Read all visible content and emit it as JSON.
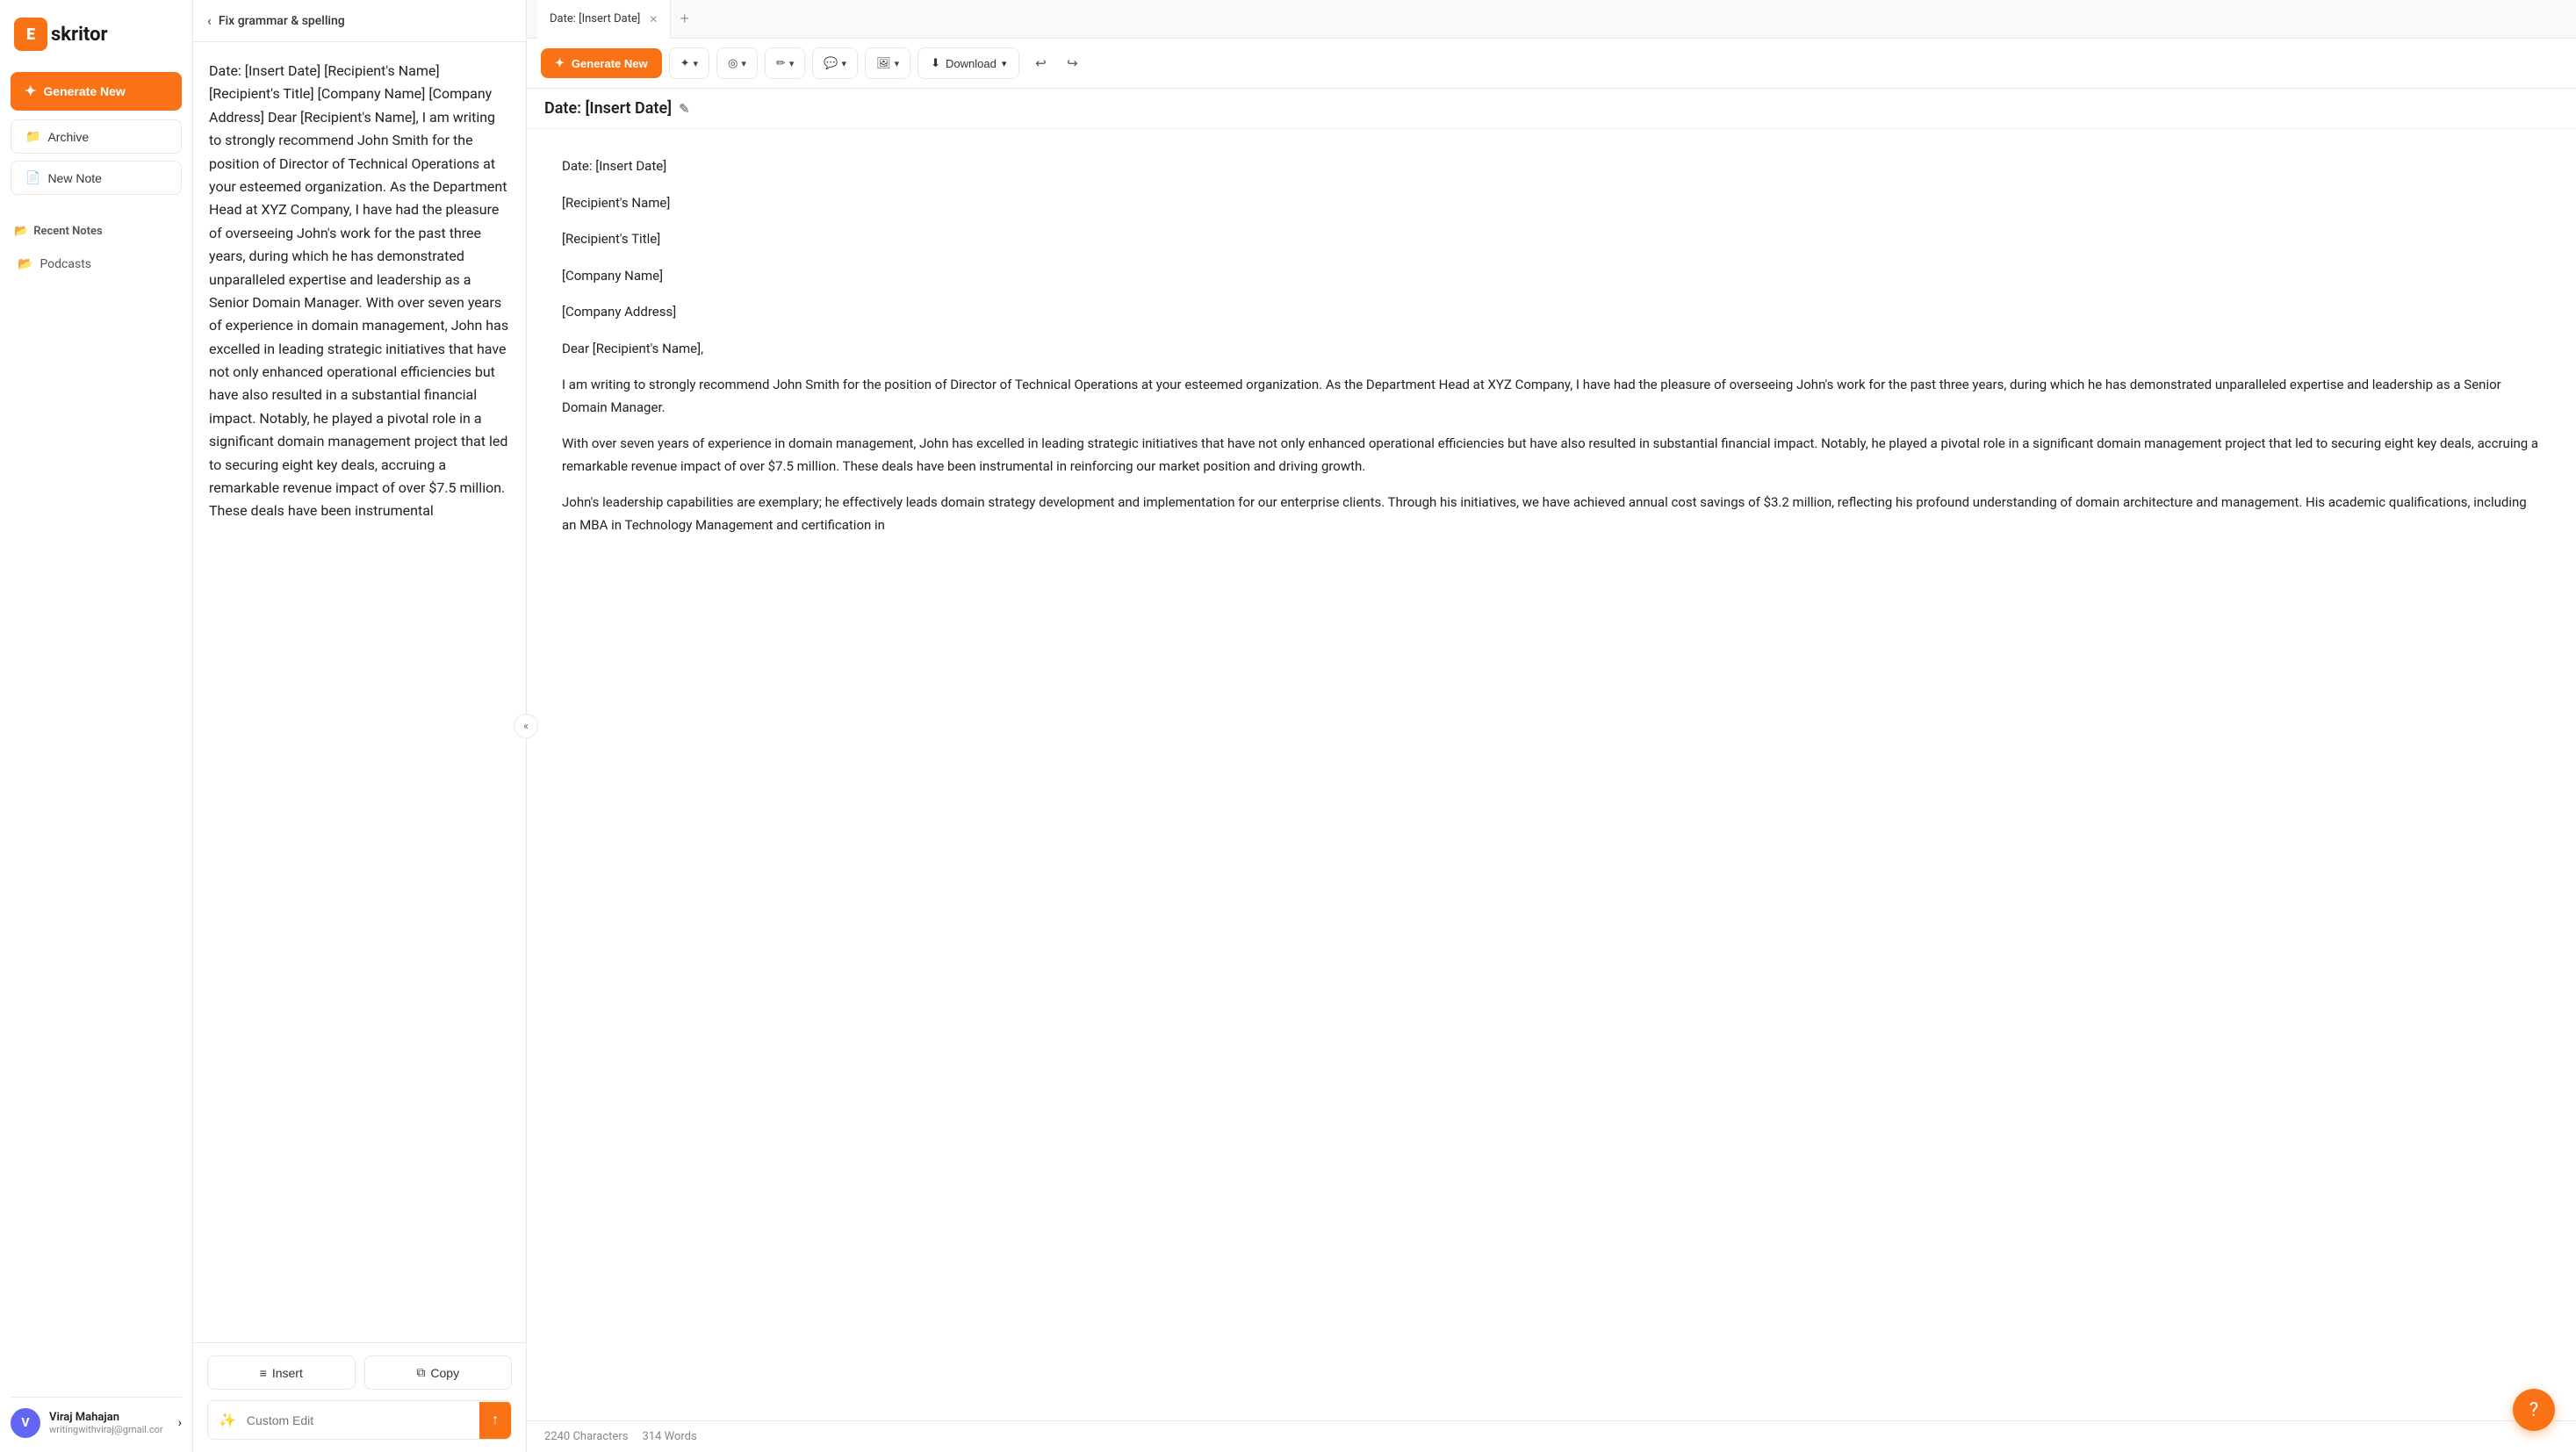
{
  "sidebar": {
    "logo_letter": "E",
    "logo_name": "skritor",
    "generate_label": "Generate New",
    "archive_label": "Archive",
    "new_note_label": "New Note",
    "recent_notes_label": "Recent Notes",
    "podcasts_label": "Podcasts",
    "user": {
      "initials": "V",
      "name": "Viraj Mahajan",
      "email": "writingwithviraj@gmail.cor"
    }
  },
  "middle_panel": {
    "header_back_label": "Fix grammar & spelling",
    "content": "Date: [Insert Date] [Recipient's Name] [Recipient's Title] [Company Name] [Company Address] Dear [Recipient's Name], I am writing to strongly recommend John Smith for the position of Director of Technical Operations at your esteemed organization. As the Department Head at XYZ Company, I have had the pleasure of overseeing John's work for the past three years, during which he has demonstrated unparalleled expertise and leadership as a Senior Domain Manager. With over seven years of experience in domain management, John has excelled in leading strategic initiatives that have not only enhanced operational efficiencies but have also resulted in a substantial financial impact. Notably, he played a pivotal role in a significant domain management project that led to securing eight key deals, accruing a remarkable revenue impact of over $7.5 million. These deals have been instrumental",
    "insert_label": "Insert",
    "copy_label": "Copy",
    "custom_edit_placeholder": "Custom Edit",
    "send_icon": "↑"
  },
  "right_panel": {
    "tab_label": "Date: [Insert Date]",
    "doc_title": "Date: [Insert Date]",
    "generate_label": "Generate New",
    "download_label": "Download",
    "toolbar": {
      "wand_label": "✦",
      "magic_label": "✦",
      "pen_label": "✏",
      "chat_label": "💬",
      "image_label": "🖼"
    },
    "content": {
      "line1": "Date: [Insert Date]",
      "line2": "[Recipient's Name]",
      "line3": "[Recipient's Title]",
      "line4": "[Company Name]",
      "line5": "[Company Address]",
      "line6": "Dear [Recipient's Name],",
      "para1": "I am writing to strongly recommend John Smith for the position of Director of Technical Operations at your esteemed organization. As the Department Head at XYZ Company, I have had the pleasure of overseeing John's work for the past three years, during which he has demonstrated unparalleled expertise and leadership as a Senior Domain Manager.",
      "para2": "With over seven years of experience in domain management, John has excelled in leading strategic initiatives that have not only enhanced operational efficiencies but have also resulted in substantial financial impact. Notably, he played a pivotal role in a significant domain management project that led to securing eight key deals, accruing a remarkable revenue impact of over $7.5 million. These deals have been instrumental in reinforcing our market position and driving growth.",
      "para3": "John's leadership capabilities are exemplary; he effectively leads domain strategy development and implementation for our enterprise clients. Through his initiatives, we have achieved annual cost savings of $3.2 million, reflecting his profound understanding of domain architecture and management. His academic qualifications, including an MBA in Technology Management and certification in"
    },
    "footer": {
      "characters": "2240 Characters",
      "words": "314 Words"
    }
  }
}
